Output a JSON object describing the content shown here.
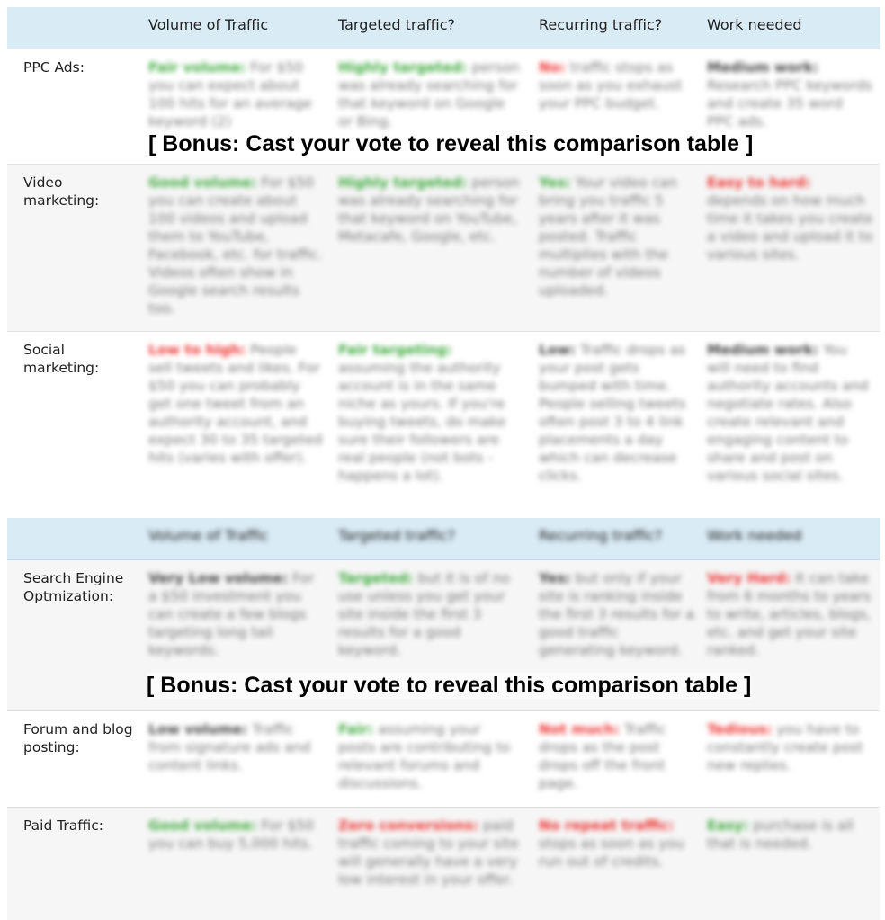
{
  "headers": [
    "Volume of Traffic",
    "Targeted traffic?",
    "Recurring traffic?",
    "Work needed"
  ],
  "bonus": "[ Bonus: Cast your vote to reveal this comparison table ]",
  "rows": [
    {
      "label": "PPC Ads:",
      "cells": [
        {
          "k": "Fair volume:",
          "t": " For $50 you can expect about 100 hits for an average keyword (2)"
        },
        {
          "k": "Highly targeted:",
          "t": " person was already searching for that keyword on Google or Bing."
        },
        {
          "k": "No:",
          "t": " traffic stops as soon as you exhaust your PPC budget."
        },
        {
          "k": "Medium work:",
          "t": " Research PPC keywords and create 35 word PPC ads."
        }
      ]
    },
    {
      "label": "Video marketing:",
      "cells": [
        {
          "k": "Good volume:",
          "t": " For $50 you can create about 100 videos and upload them to YouTube, Facebook, etc. for traffic. Videos often show in Google search results too."
        },
        {
          "k": "Highly targeted:",
          "t": " person was already searching for that keyword on YouTube, Metacafe, Google, etc."
        },
        {
          "k": "Yes:",
          "t": " Your video can bring you traffic 5 years after it was posted. Traffic multiplies with the number of videos uploaded."
        },
        {
          "k": "Easy to hard:",
          "t": " depends on how much time it takes you create a video and upload it to various sites."
        }
      ]
    },
    {
      "label": "Social marketing:",
      "cells": [
        {
          "k": "Low to high:",
          "t": " People sell tweets and likes. For $50 you can probably get one tweet from an authority account, and expect 30 to 35 targeted hits (varies with offer)."
        },
        {
          "k": "Fair targeting:",
          "t": " assuming the authority account is in the same niche as yours. If you're buying tweets, do make sure their followers are real people (not bots - happens a lot)."
        },
        {
          "k": "Low:",
          "t": " Traffic drops as your post gets bumped with time. People selling tweets often post 3 to 4 link placements a day which can decrease clicks."
        },
        {
          "k": "Medium work:",
          "t": " You will need to find authority accounts and negotiate rates. Also create relevant and engaging content to share and post on various social sites."
        }
      ]
    },
    {
      "label": "Search Engine Optmization:",
      "cells": [
        {
          "k": "Very Low volume:",
          "t": " For a $50 investment you can create a few blogs targeting long tail keywords."
        },
        {
          "k": "Targeted:",
          "t": " but it is of no use unless you get your site inside the first 3 results for a good keyword."
        },
        {
          "k": "Yes:",
          "t": " but only if your site is ranking inside the first 3 results for a good traffic generating keyword."
        },
        {
          "k": "Very Hard:",
          "t": " It can take from 6 months to years to write, articles, blogs, etc. and get your site ranked."
        }
      ]
    },
    {
      "label": "Forum and blog posting:",
      "cells": [
        {
          "k": "Low volume:",
          "t": " Traffic from signature ads and content links."
        },
        {
          "k": "Fair:",
          "t": " assuming your posts are contributing to relevant forums and discussions."
        },
        {
          "k": "Not much:",
          "t": " Traffic drops as the post drops off the front page."
        },
        {
          "k": "Tedious:",
          "t": " you have to constantly create post new replies."
        }
      ]
    },
    {
      "label": "Paid Traffic:",
      "cells": [
        {
          "k": "Good volume:",
          "t": " For $50 you can buy 5,000 hits."
        },
        {
          "k": "Zero conversions:",
          "t": " paid traffic coming to your site will generally have a very low interest in your offer."
        },
        {
          "k": "No repeat traffic:",
          "t": " stops as soon as you run out of credits."
        },
        {
          "k": "Easy:",
          "t": " purchase is all that is needed."
        }
      ]
    }
  ],
  "colors": {
    "header_bg": "#d9ebf5",
    "positive": "#3faa3f",
    "negative": "#ee3333",
    "neutral": "#444444"
  }
}
